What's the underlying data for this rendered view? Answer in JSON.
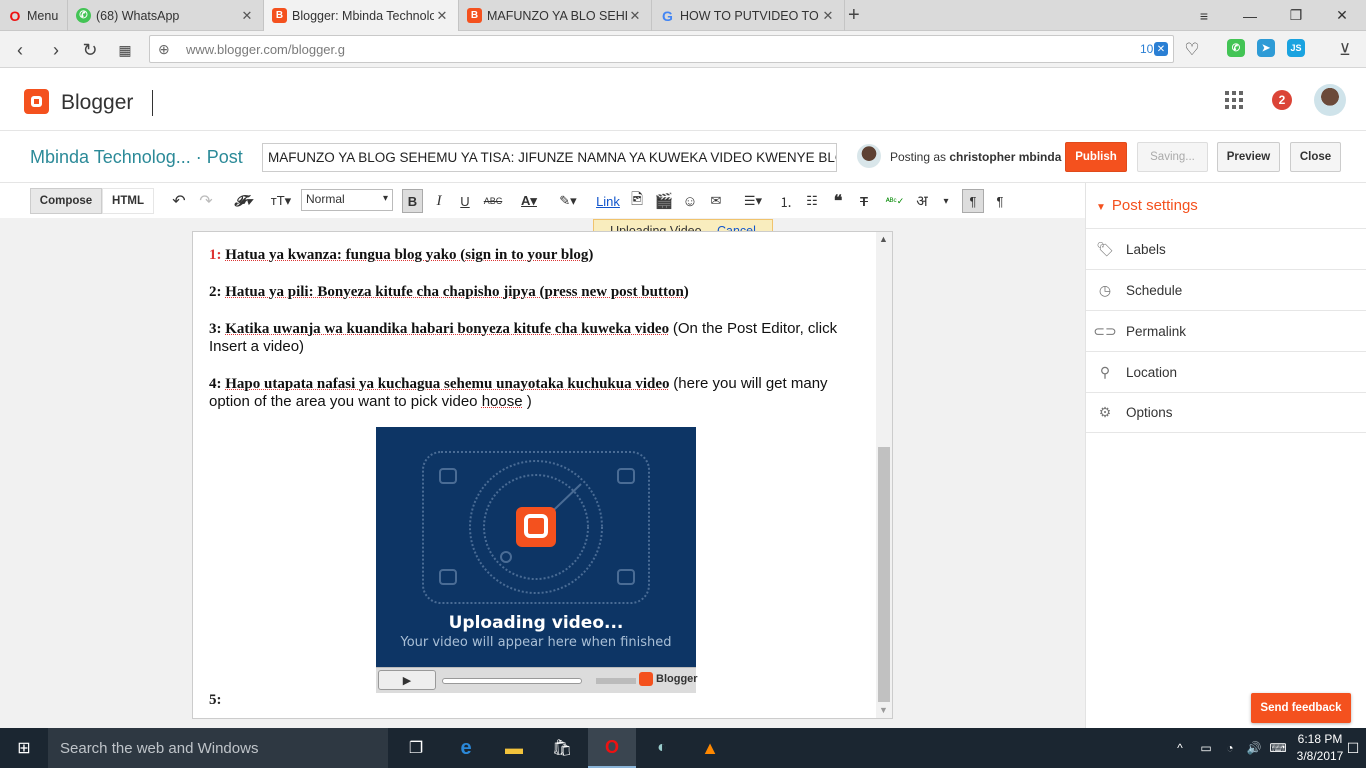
{
  "browser": {
    "menu_label": "Menu",
    "tabs": [
      {
        "title": "(68) WhatsApp",
        "icon": "whatsapp-icon"
      },
      {
        "title": "Blogger: Mbinda Technolo",
        "icon": "blogger-icon"
      },
      {
        "title": "MAFUNZO YA BLO SEHEM",
        "icon": "blogger-icon"
      },
      {
        "title": "HOW TO PUTVIDEO TO BL",
        "icon": "google-icon"
      }
    ],
    "url": "www.blogger.com/blogger.g",
    "badge_count": "10"
  },
  "header": {
    "app_name": "Blogger",
    "notification_count": "2"
  },
  "postbar": {
    "blog_title": "Mbinda Technolog...",
    "section": "· Post",
    "post_title_value": "MAFUNZO YA BLOG SEHEMU YA TISA: JIFUNZE NAMNA YA KUWEKA VIDEO KWENYE BLOG",
    "posting_as_prefix": "Posting as ",
    "author": "christopher mbinda",
    "publish_label": "Publish",
    "saving_label": "Saving...",
    "preview_label": "Preview",
    "close_label": "Close"
  },
  "toolbar": {
    "compose_label": "Compose",
    "html_label": "HTML",
    "format_value": "Normal",
    "link_label": "Link"
  },
  "toast": {
    "text": "Uploading Video...",
    "cancel_label": "Cancel"
  },
  "editor": {
    "step1": {
      "num": "1:",
      "bold": "Hatua ya kwanza: fungua blog yako (sign in to your blog)"
    },
    "step2": {
      "num": "2:",
      "bold": "Hatua ya pili: Bonyeza kitufe cha chapisho jipya (press new post button)"
    },
    "step3": {
      "num": "3:",
      "bold": "Katika uwanja wa kuandika habari bonyeza kitufe cha kuweka video",
      "rest": "(On the Post Editor, click Insert a video)"
    },
    "step4": {
      "num": "4:",
      "bold": "Hapo utapata nafasi ya kuchagua sehemu unayotaka kuchukua video",
      "rest1": "(here you will get many option of the area you want to pick video ",
      "rest_link": "hoose",
      "rest2": " )"
    },
    "video_status_title": "Uploading video...",
    "video_status_sub": "Your video will appear here when finished",
    "video_brand": "Blogger",
    "step5": {
      "num": "5:"
    }
  },
  "sidebar": {
    "title": "Post settings",
    "items": [
      {
        "label": "Labels",
        "icon": "label-icon"
      },
      {
        "label": "Schedule",
        "icon": "clock-icon"
      },
      {
        "label": "Permalink",
        "icon": "link-icon"
      },
      {
        "label": "Location",
        "icon": "location-pin-icon"
      },
      {
        "label": "Options",
        "icon": "gear-icon"
      }
    ],
    "feedback_label": "Send feedback"
  },
  "taskbar": {
    "search_placeholder": "Search the web and Windows",
    "time": "6:18 PM",
    "date": "3/8/2017"
  },
  "colors": {
    "accent": "#f4511e",
    "blog_title": "#2b8a98",
    "video_bg": "#0d3565"
  }
}
